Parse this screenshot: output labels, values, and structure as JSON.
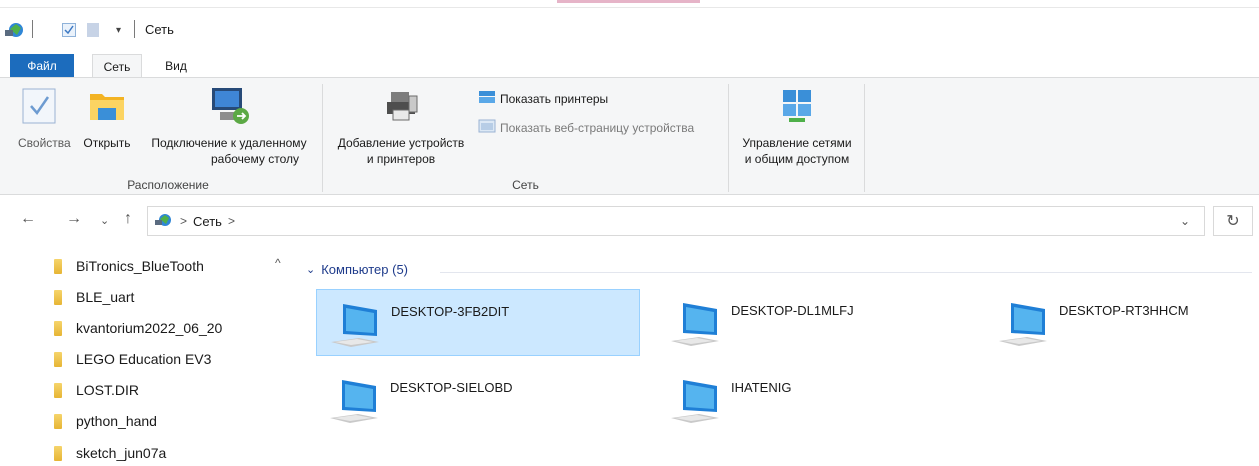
{
  "window": {
    "title": "Сеть"
  },
  "ribbon_tabs": [
    {
      "label": "Файл"
    },
    {
      "label": "Сеть"
    },
    {
      "label": "Вид"
    }
  ],
  "ribbon": {
    "location_group": {
      "label": "Расположение",
      "properties": "Свойства",
      "open": "Открыть",
      "remote_line1": "Подключение к удаленному",
      "remote_line2": "рабочему столу"
    },
    "network_group": {
      "label": "Сеть",
      "add_line1": "Добавление устройств",
      "add_line2": "и принтеров",
      "show_printers": "Показать принтеры",
      "show_web": "Показать веб-страницу устройства"
    },
    "manage": {
      "line1": "Управление сетями",
      "line2": "и общим доступом"
    }
  },
  "address": {
    "crumbs": [
      "Сеть"
    ],
    "sep": ">"
  },
  "nav_items": [
    "BiTronics_BlueTooth",
    "BLE_uart",
    "kvantorium2022_06_20",
    "LEGO Education EV3",
    "LOST.DIR",
    "python_hand",
    "sketch_jun07a"
  ],
  "group": {
    "header": "Компьютер (5)"
  },
  "computers": [
    {
      "name": "DESKTOP-3FB2DIT",
      "selected": true
    },
    {
      "name": "DESKTOP-DL1MLFJ",
      "selected": false
    },
    {
      "name": "DESKTOP-RT3HHCM",
      "selected": false
    },
    {
      "name": "DESKTOP-SIELOBD",
      "selected": false
    },
    {
      "name": "IHATENIG",
      "selected": false
    }
  ],
  "colors": {
    "file_tab": "#1c6cbd",
    "selection": "#cce8ff",
    "group_header": "#1e3b8b"
  }
}
